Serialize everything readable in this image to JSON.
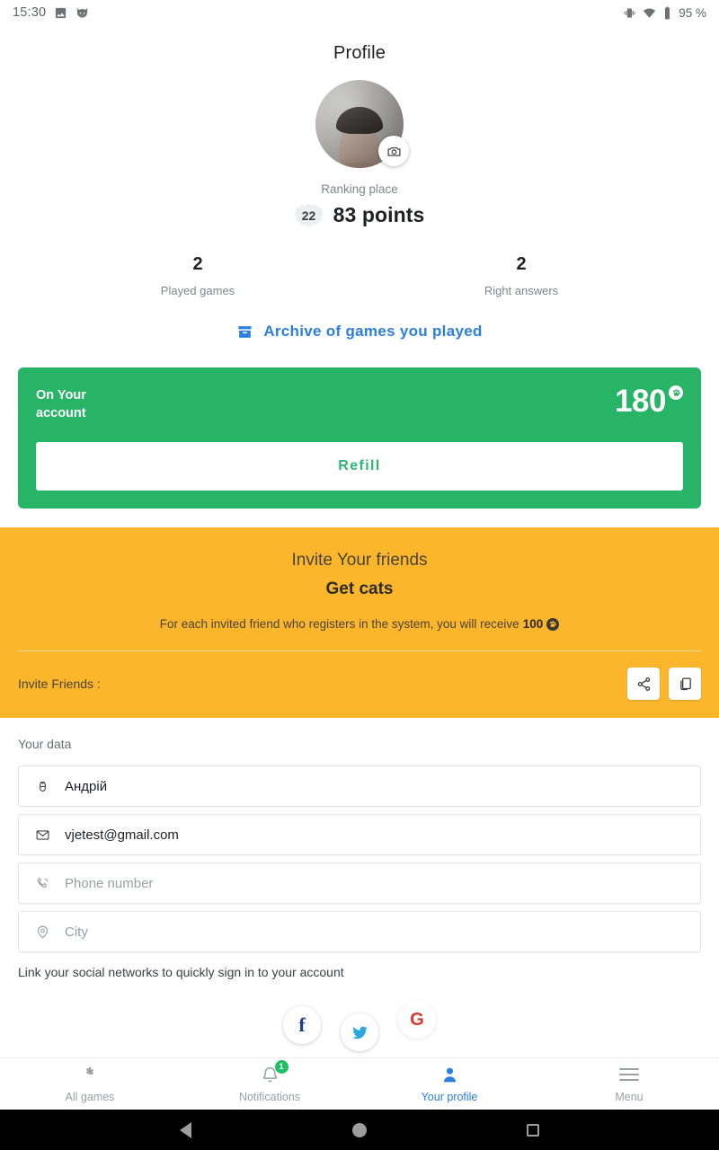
{
  "status_bar": {
    "time": "15:30",
    "left_icons": [
      "image-icon",
      "cat-icon"
    ],
    "right_icons": [
      "vibrate-icon",
      "wifi-icon",
      "battery-icon"
    ],
    "battery": "95 %"
  },
  "header": {
    "title": "Profile"
  },
  "profile": {
    "avatar_alt": "user-avatar",
    "camera_button": "camera-icon",
    "ranking_label": "Ranking place",
    "rank_badge": "22",
    "points": "83 points",
    "stats": [
      {
        "value": "2",
        "label": "Played games"
      },
      {
        "value": "2",
        "label": "Right answers"
      }
    ],
    "archive_link": "Archive of games you played",
    "archive_icon": "archive-icon",
    "link_color": "#2a7fe0"
  },
  "account_card": {
    "label": "On Your\naccount",
    "label_line1": "On Your",
    "label_line2": "account",
    "balance": "180",
    "currency_icon": "paw-icon",
    "refill_label": "Refill",
    "bg_color": "#28b467",
    "refill_text_color": "#2eb872"
  },
  "invite": {
    "title": "Invite Your friends",
    "subtitle": "Get cats",
    "description_prefix": "For each invited friend who registers in the system, you will receive",
    "reward_amount": "100",
    "reward_icon": "paw-icon",
    "row_label": "Invite Friends :",
    "share_icon": "share-icon",
    "copy_icon": "copy-icon",
    "bg_color": "#fbb62b"
  },
  "your_data": {
    "section_title": "Your data",
    "fields": [
      {
        "icon": "user-icon",
        "value": "Андрій",
        "placeholder": "Name"
      },
      {
        "icon": "mail-icon",
        "value": "vjetest@gmail.com",
        "placeholder": "E-mail"
      },
      {
        "icon": "phone-icon",
        "value": "",
        "placeholder": "Phone number"
      },
      {
        "icon": "location-icon",
        "value": "",
        "placeholder": "City"
      }
    ],
    "social_hint": "Link your social networks to quickly sign in to your account",
    "socials": [
      {
        "name": "facebook",
        "glyph": "f",
        "color": "#1b3d8f"
      },
      {
        "name": "twitter",
        "glyph": "bird",
        "color": "#2aa9e0"
      },
      {
        "name": "google",
        "glyph": "G",
        "color": "#d9382c"
      }
    ]
  },
  "bottom_nav": {
    "items": [
      {
        "label": "All games",
        "icon": "gamepad-icon",
        "active": false,
        "badge": ""
      },
      {
        "label": "Notifications",
        "icon": "bell-icon",
        "active": false,
        "badge": "1"
      },
      {
        "label": "Your profile",
        "icon": "person-icon",
        "active": true,
        "badge": ""
      },
      {
        "label": "Menu",
        "icon": "hamburger-icon",
        "active": false,
        "badge": ""
      }
    ],
    "active_color": "#2a7fe0",
    "badge_color": "#21bf63"
  },
  "system_nav": {
    "back": "back-triangle-icon",
    "home": "home-circle-icon",
    "recents": "recents-square-icon"
  }
}
